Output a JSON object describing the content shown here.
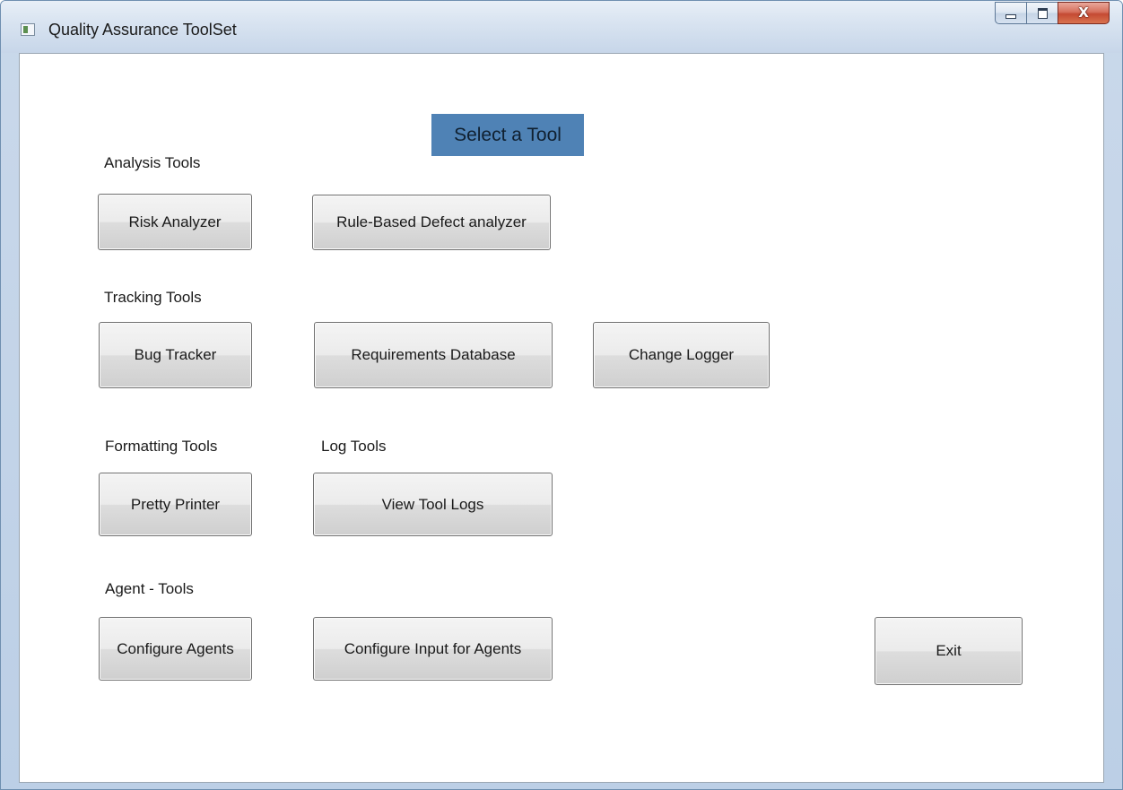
{
  "window": {
    "title": "Quality Assurance ToolSet",
    "controls": {
      "minimize_icon": "minimize-icon",
      "maximize_icon": "maximize-icon",
      "close_icon": "close-icon",
      "close_glyph": "X"
    }
  },
  "main": {
    "heading": "Select a Tool",
    "heading_color": "#4f82b5",
    "sections": {
      "analysis": {
        "label": "Analysis Tools",
        "buttons": [
          "Risk Analyzer",
          "Rule-Based Defect analyzer"
        ]
      },
      "tracking": {
        "label": "Tracking Tools",
        "buttons": [
          "Bug Tracker",
          "Requirements Database",
          "Change Logger"
        ]
      },
      "formatting": {
        "label": "Formatting Tools",
        "buttons": [
          "Pretty Printer"
        ]
      },
      "log": {
        "label": "Log Tools",
        "buttons": [
          "View Tool Logs"
        ]
      },
      "agent": {
        "label": "Agent - Tools",
        "buttons": [
          "Configure Agents",
          "Configure Input for Agents"
        ]
      }
    },
    "exit_label": "Exit"
  }
}
